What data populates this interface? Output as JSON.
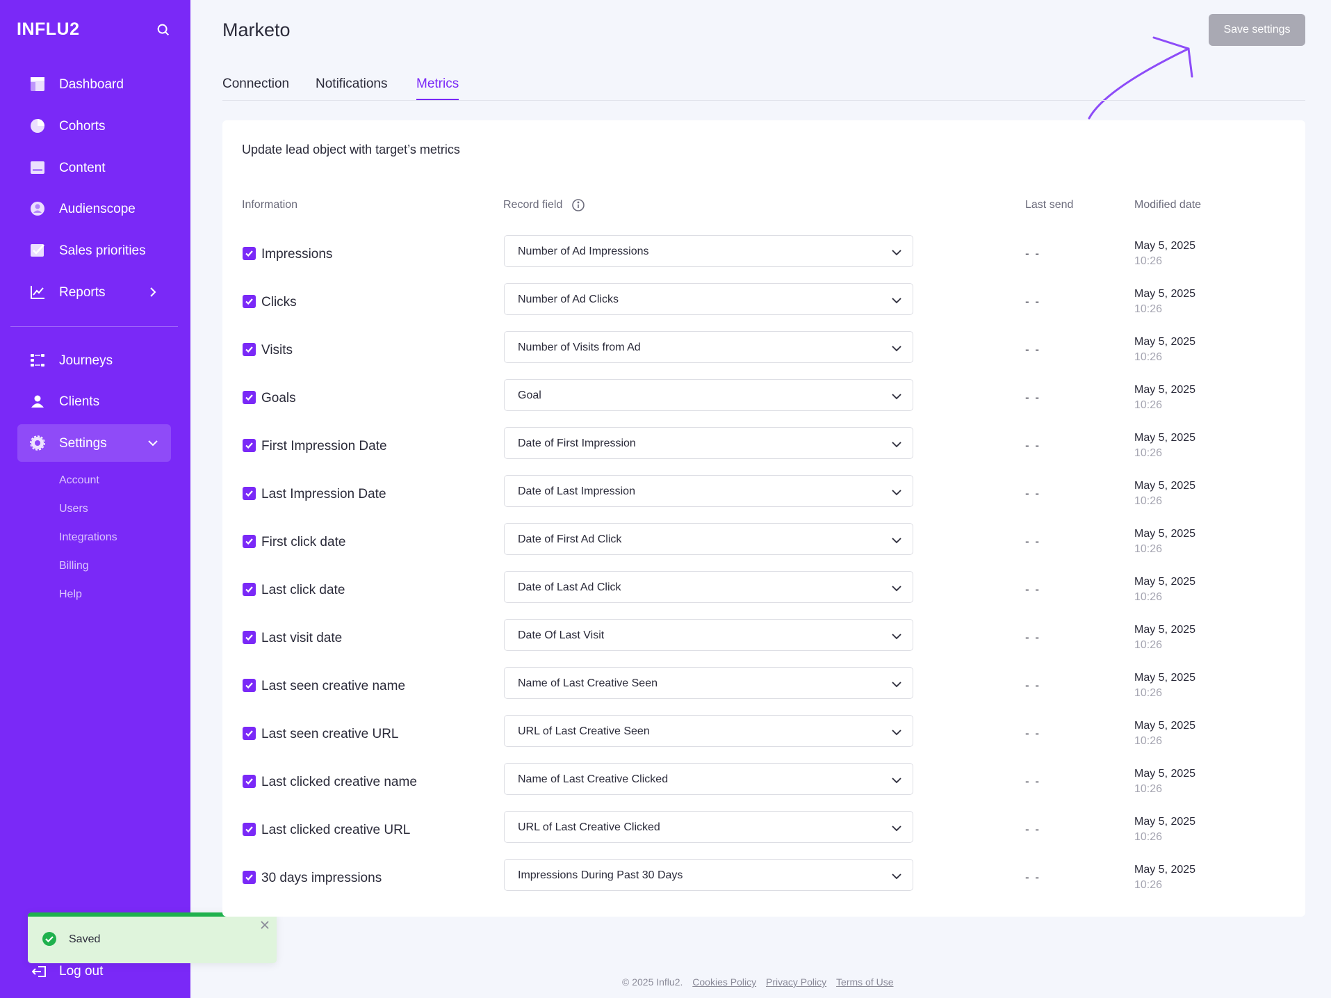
{
  "sidebar": {
    "logo": "INFLU2",
    "nav": [
      {
        "label": "Dashboard",
        "icon": "dashboard-icon"
      },
      {
        "label": "Cohorts",
        "icon": "pie-chart-icon"
      },
      {
        "label": "Content",
        "icon": "content-icon"
      },
      {
        "label": "Audienscope",
        "icon": "audience-icon"
      },
      {
        "label": "Sales priorities",
        "icon": "checkbox-icon"
      },
      {
        "label": "Reports",
        "icon": "line-chart-icon"
      }
    ],
    "nav2": [
      {
        "label": "Journeys",
        "icon": "journeys-icon"
      },
      {
        "label": "Clients",
        "icon": "user-icon"
      },
      {
        "label": "Settings",
        "icon": "gear-icon"
      }
    ],
    "settings_sub": [
      "Account",
      "Users",
      "Integrations",
      "Billing",
      "Help"
    ],
    "logout": "Log out"
  },
  "toast": {
    "message": "Saved"
  },
  "header": {
    "title": "Marketo",
    "save_label": "Save settings",
    "tabs": [
      "Connection",
      "Notifications",
      "Metrics"
    ],
    "active_tab": "Metrics"
  },
  "card": {
    "title": "Update lead object with target’s metrics",
    "columns": {
      "information": "Information",
      "record_field": "Record field",
      "last_send": "Last send",
      "modified_date": "Modified date"
    },
    "rows": [
      {
        "label": "Impressions",
        "field": "Number of Ad Impressions",
        "last_send": "- -",
        "date": "May 5, 2025",
        "time": "10:26",
        "checked": true
      },
      {
        "label": "Clicks",
        "field": "Number of Ad Clicks",
        "last_send": "- -",
        "date": "May 5, 2025",
        "time": "10:26",
        "checked": true
      },
      {
        "label": "Visits",
        "field": "Number of Visits from Ad",
        "last_send": "- -",
        "date": "May 5, 2025",
        "time": "10:26",
        "checked": true
      },
      {
        "label": "Goals",
        "field": "Goal",
        "last_send": "- -",
        "date": "May 5, 2025",
        "time": "10:26",
        "checked": true
      },
      {
        "label": "First Impression Date",
        "field": "Date of First Impression",
        "last_send": "- -",
        "date": "May 5, 2025",
        "time": "10:26",
        "checked": true
      },
      {
        "label": "Last Impression Date",
        "field": "Date of Last Impression",
        "last_send": "- -",
        "date": "May 5, 2025",
        "time": "10:26",
        "checked": true
      },
      {
        "label": "First click date",
        "field": "Date of First Ad Click",
        "last_send": "- -",
        "date": "May 5, 2025",
        "time": "10:26",
        "checked": true
      },
      {
        "label": "Last click date",
        "field": "Date of Last Ad Click",
        "last_send": "- -",
        "date": "May 5, 2025",
        "time": "10:26",
        "checked": true
      },
      {
        "label": "Last visit date",
        "field": "Date Of Last Visit",
        "last_send": "- -",
        "date": "May 5, 2025",
        "time": "10:26",
        "checked": true
      },
      {
        "label": "Last seen creative name",
        "field": "Name of Last Creative Seen",
        "last_send": "- -",
        "date": "May 5, 2025",
        "time": "10:26",
        "checked": true
      },
      {
        "label": "Last seen creative URL",
        "field": "URL of Last Creative Seen",
        "last_send": "- -",
        "date": "May 5, 2025",
        "time": "10:26",
        "checked": true
      },
      {
        "label": "Last clicked creative name",
        "field": "Name of Last Creative Clicked",
        "last_send": "- -",
        "date": "May 5, 2025",
        "time": "10:26",
        "checked": true
      },
      {
        "label": "Last clicked creative URL",
        "field": "URL of Last Creative Clicked",
        "last_send": "- -",
        "date": "May 5, 2025",
        "time": "10:26",
        "checked": true
      },
      {
        "label": "30 days impressions",
        "field": "Impressions During Past 30 Days",
        "last_send": "- -",
        "date": "May 5, 2025",
        "time": "10:26",
        "checked": true
      }
    ]
  },
  "footer": {
    "copyright": "© 2025 Influ2.",
    "links": [
      "Cookies Policy",
      "Privacy Policy",
      "Terms of Use"
    ]
  },
  "colors": {
    "accent": "#7a29f7",
    "sidebar_bg": "#7a29f7",
    "toast_bar": "#1fb14d",
    "button_disabled": "#a9a9b3"
  }
}
